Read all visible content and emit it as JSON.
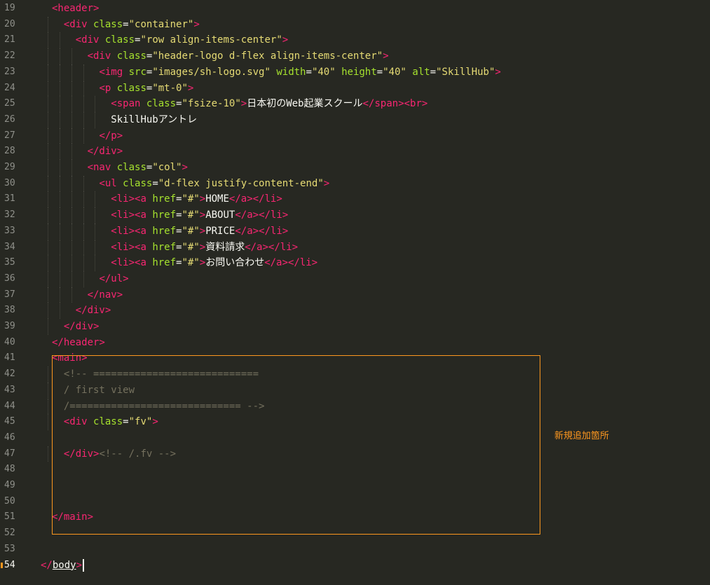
{
  "editor": {
    "theme_colors": {
      "background": "#272822",
      "tag": "#f92672",
      "attribute": "#a6e22e",
      "string": "#e6db74",
      "comment": "#75715e",
      "text": "#f8f8f2",
      "highlight": "#fd971f"
    },
    "annotation": "新規追加箇所",
    "lines": [
      {
        "n": "19",
        "indent": 2,
        "tokens": [
          [
            "t",
            "<header>"
          ]
        ]
      },
      {
        "n": "20",
        "indent": 4,
        "tokens": [
          [
            "t",
            "<div "
          ],
          [
            "a",
            "class"
          ],
          [
            "p",
            "="
          ],
          [
            "s",
            "\"container\""
          ],
          [
            "t",
            ">"
          ]
        ]
      },
      {
        "n": "21",
        "indent": 6,
        "tokens": [
          [
            "t",
            "<div "
          ],
          [
            "a",
            "class"
          ],
          [
            "p",
            "="
          ],
          [
            "s",
            "\"row align-items-center\""
          ],
          [
            "t",
            ">"
          ]
        ]
      },
      {
        "n": "22",
        "indent": 8,
        "tokens": [
          [
            "t",
            "<div "
          ],
          [
            "a",
            "class"
          ],
          [
            "p",
            "="
          ],
          [
            "s",
            "\"header-logo d-flex align-items-center\""
          ],
          [
            "t",
            ">"
          ]
        ]
      },
      {
        "n": "23",
        "indent": 10,
        "tokens": [
          [
            "t",
            "<img "
          ],
          [
            "a",
            "src"
          ],
          [
            "p",
            "="
          ],
          [
            "s",
            "\"images/sh-logo.svg\""
          ],
          [
            "p",
            " "
          ],
          [
            "a",
            "width"
          ],
          [
            "p",
            "="
          ],
          [
            "s",
            "\"40\""
          ],
          [
            "p",
            " "
          ],
          [
            "a",
            "height"
          ],
          [
            "p",
            "="
          ],
          [
            "s",
            "\"40\""
          ],
          [
            "p",
            " "
          ],
          [
            "a",
            "alt"
          ],
          [
            "p",
            "="
          ],
          [
            "s",
            "\"SkillHub\""
          ],
          [
            "t",
            ">"
          ]
        ]
      },
      {
        "n": "24",
        "indent": 10,
        "tokens": [
          [
            "t",
            "<p "
          ],
          [
            "a",
            "class"
          ],
          [
            "p",
            "="
          ],
          [
            "s",
            "\"mt-0\""
          ],
          [
            "t",
            ">"
          ]
        ]
      },
      {
        "n": "25",
        "indent": 12,
        "tokens": [
          [
            "t",
            "<span "
          ],
          [
            "a",
            "class"
          ],
          [
            "p",
            "="
          ],
          [
            "s",
            "\"fsize-10\""
          ],
          [
            "t",
            ">"
          ],
          [
            "p",
            "日本初のWeb起業スクール"
          ],
          [
            "t",
            "</span><br>"
          ]
        ]
      },
      {
        "n": "26",
        "indent": 12,
        "tokens": [
          [
            "p",
            "SkillHubアントレ"
          ]
        ]
      },
      {
        "n": "27",
        "indent": 10,
        "tokens": [
          [
            "t",
            "</p>"
          ]
        ]
      },
      {
        "n": "28",
        "indent": 8,
        "tokens": [
          [
            "t",
            "</div>"
          ]
        ]
      },
      {
        "n": "29",
        "indent": 8,
        "tokens": [
          [
            "t",
            "<nav "
          ],
          [
            "a",
            "class"
          ],
          [
            "p",
            "="
          ],
          [
            "s",
            "\"col\""
          ],
          [
            "t",
            ">"
          ]
        ]
      },
      {
        "n": "30",
        "indent": 10,
        "tokens": [
          [
            "t",
            "<ul "
          ],
          [
            "a",
            "class"
          ],
          [
            "p",
            "="
          ],
          [
            "s",
            "\"d-flex justify-content-end\""
          ],
          [
            "t",
            ">"
          ]
        ]
      },
      {
        "n": "31",
        "indent": 12,
        "tokens": [
          [
            "t",
            "<li><a "
          ],
          [
            "a",
            "href"
          ],
          [
            "p",
            "="
          ],
          [
            "s",
            "\"#\""
          ],
          [
            "t",
            ">"
          ],
          [
            "p",
            "HOME"
          ],
          [
            "t",
            "</a></li>"
          ]
        ]
      },
      {
        "n": "32",
        "indent": 12,
        "tokens": [
          [
            "t",
            "<li><a "
          ],
          [
            "a",
            "href"
          ],
          [
            "p",
            "="
          ],
          [
            "s",
            "\"#\""
          ],
          [
            "t",
            ">"
          ],
          [
            "p",
            "ABOUT"
          ],
          [
            "t",
            "</a></li>"
          ]
        ]
      },
      {
        "n": "33",
        "indent": 12,
        "tokens": [
          [
            "t",
            "<li><a "
          ],
          [
            "a",
            "href"
          ],
          [
            "p",
            "="
          ],
          [
            "s",
            "\"#\""
          ],
          [
            "t",
            ">"
          ],
          [
            "p",
            "PRICE"
          ],
          [
            "t",
            "</a></li>"
          ]
        ]
      },
      {
        "n": "34",
        "indent": 12,
        "tokens": [
          [
            "t",
            "<li><a "
          ],
          [
            "a",
            "href"
          ],
          [
            "p",
            "="
          ],
          [
            "s",
            "\"#\""
          ],
          [
            "t",
            ">"
          ],
          [
            "p",
            "資料請求"
          ],
          [
            "t",
            "</a></li>"
          ]
        ]
      },
      {
        "n": "35",
        "indent": 12,
        "tokens": [
          [
            "t",
            "<li><a "
          ],
          [
            "a",
            "href"
          ],
          [
            "p",
            "="
          ],
          [
            "s",
            "\"#\""
          ],
          [
            "t",
            ">"
          ],
          [
            "p",
            "お問い合わせ"
          ],
          [
            "t",
            "</a></li>"
          ]
        ]
      },
      {
        "n": "36",
        "indent": 10,
        "tokens": [
          [
            "t",
            "</ul>"
          ]
        ]
      },
      {
        "n": "37",
        "indent": 8,
        "tokens": [
          [
            "t",
            "</nav>"
          ]
        ]
      },
      {
        "n": "38",
        "indent": 6,
        "tokens": [
          [
            "t",
            "</div>"
          ]
        ]
      },
      {
        "n": "39",
        "indent": 4,
        "tokens": [
          [
            "t",
            "</div>"
          ]
        ]
      },
      {
        "n": "40",
        "indent": 2,
        "tokens": [
          [
            "t",
            "</header>"
          ]
        ]
      },
      {
        "n": "41",
        "indent": 2,
        "tokens": [
          [
            "t",
            "<main>"
          ]
        ]
      },
      {
        "n": "42",
        "indent": 4,
        "tokens": [
          [
            "c",
            "<!-- ============================"
          ]
        ]
      },
      {
        "n": "43",
        "indent": 4,
        "tokens": [
          [
            "c",
            "/ first view"
          ]
        ]
      },
      {
        "n": "44",
        "indent": 4,
        "tokens": [
          [
            "c",
            "/============================= -->"
          ]
        ]
      },
      {
        "n": "45",
        "indent": 4,
        "tokens": [
          [
            "t",
            "<div "
          ],
          [
            "a",
            "class"
          ],
          [
            "p",
            "="
          ],
          [
            "s",
            "\"fv\""
          ],
          [
            "t",
            ">"
          ]
        ]
      },
      {
        "n": "46",
        "indent": 0,
        "tokens": []
      },
      {
        "n": "47",
        "indent": 4,
        "tokens": [
          [
            "t",
            "</div>"
          ],
          [
            "c",
            "<!-- /.fv -->"
          ]
        ]
      },
      {
        "n": "48",
        "indent": 0,
        "tokens": []
      },
      {
        "n": "49",
        "indent": 0,
        "tokens": []
      },
      {
        "n": "50",
        "indent": 0,
        "tokens": []
      },
      {
        "n": "51",
        "indent": 2,
        "tokens": [
          [
            "t",
            "</main>"
          ]
        ]
      },
      {
        "n": "52",
        "indent": 0,
        "tokens": []
      },
      {
        "n": "53",
        "indent": 0,
        "tokens": []
      },
      {
        "n": "54",
        "indent": 0,
        "tokens": [
          [
            "t",
            "</"
          ],
          [
            "u",
            "body"
          ],
          [
            "t",
            ">"
          ]
        ]
      }
    ]
  }
}
